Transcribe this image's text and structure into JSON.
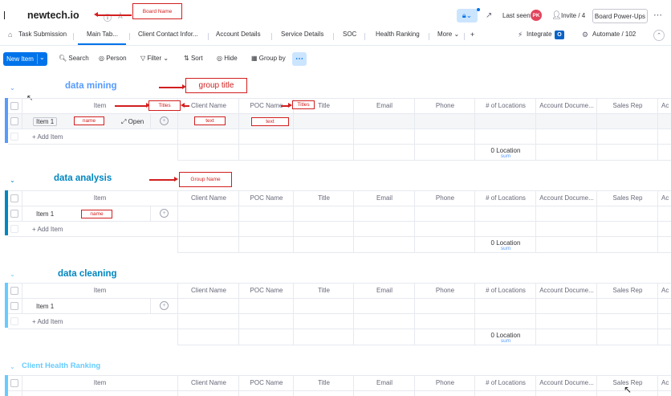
{
  "board": {
    "title": "newtech.io",
    "last_seen_label": "Last seen",
    "avatar_initials": "PK",
    "invite_label": "Invite / 4",
    "power_ups_label": "Board Power-Ups"
  },
  "tabs": [
    {
      "label": "Task Submission"
    },
    {
      "label": "Main Tab..."
    },
    {
      "label": "Client Contact Infor..."
    },
    {
      "label": "Account Details"
    },
    {
      "label": "Service Details"
    },
    {
      "label": "SOC"
    },
    {
      "label": "Health Ranking"
    },
    {
      "label": "More"
    }
  ],
  "tab_actions": {
    "add": "+",
    "integrate": "Integrate",
    "automate": "Automate / 102"
  },
  "toolbar": {
    "new_item": "New Item",
    "search": "Search",
    "person": "Person",
    "filter": "Filter",
    "sort": "Sort",
    "hide": "Hide",
    "group_by": "Group by"
  },
  "columns": [
    "Item",
    "Client Name",
    "POC Name",
    "Title",
    "Email",
    "Phone",
    "# of Locations",
    "Account Docume...",
    "Sales Rep",
    "Ac"
  ],
  "groups": [
    {
      "title": "data mining",
      "color": "#579bfc",
      "item": "Item 1",
      "open_label": "Open",
      "add_item": "+ Add Item",
      "summary": "0 Location",
      "summary_sub": "sum"
    },
    {
      "title": "data analysis",
      "color": "#0086c0",
      "item": "Item 1",
      "add_item": "+ Add Item",
      "summary": "0 Location",
      "summary_sub": "sum"
    },
    {
      "title": "data cleaning",
      "color": "#66ccff",
      "item": "Item 1",
      "add_item": "+ Add Item",
      "summary": "0 Location",
      "summary_sub": "sum"
    },
    {
      "title": "Client Health Ranking",
      "color": "#66ccff"
    }
  ],
  "annotations": {
    "board_name": "Board Name",
    "group_title": "group title",
    "titles_1": "Titles",
    "titles_2": "Titles",
    "name_1": "name",
    "text_1": "text",
    "text_2": "text",
    "group_name": "Group Name",
    "name_2": "name"
  },
  "colors": {
    "accent": "#0073ea",
    "annotation": "#d21f1f",
    "group_blue": "#579bfc"
  }
}
